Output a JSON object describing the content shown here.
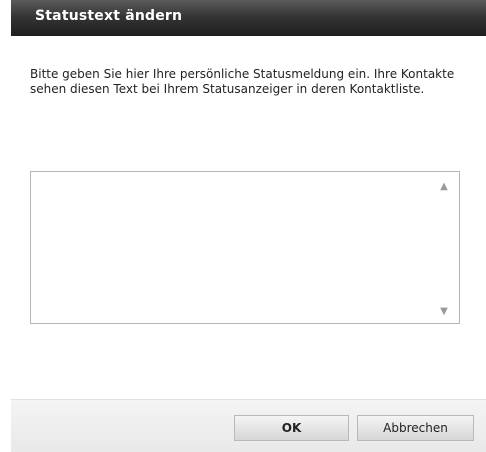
{
  "dialog": {
    "title": "Statustext ändern",
    "message": "Bitte geben Sie hier Ihre persönliche Statusmeldung ein. Ihre Kontakte sehen diesen Text bei Ihrem Statusanzeiger in deren Kontaktliste.",
    "status_input": {
      "value": "",
      "placeholder": ""
    }
  },
  "icons": {
    "scroll_up": "▲",
    "scroll_down": "▼"
  },
  "buttons": {
    "ok_label": "OK",
    "cancel_label": "Abbrechen"
  },
  "colors": {
    "titlebar": "#2a2a2a",
    "title_text": "#ffffff",
    "footer": "#eeeeee"
  }
}
